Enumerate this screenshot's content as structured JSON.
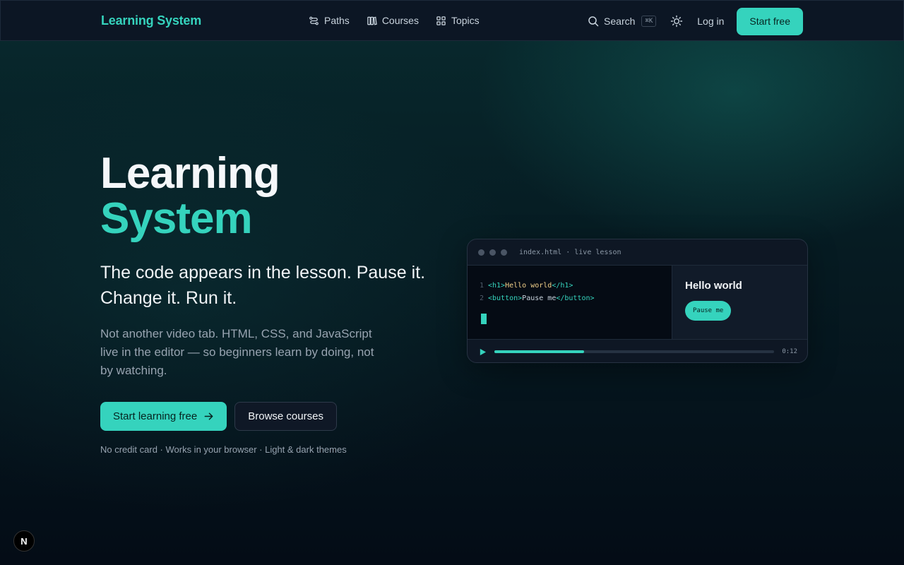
{
  "nav": {
    "brand": "Learning System",
    "links": [
      {
        "label": "Paths",
        "icon": "route-icon"
      },
      {
        "label": "Courses",
        "icon": "books-icon"
      },
      {
        "label": "Topics",
        "icon": "grid-icon"
      }
    ],
    "search_label": "Search",
    "search_shortcut": "⌘K",
    "login_label": "Log in",
    "start_label": "Start free"
  },
  "hero": {
    "title_line1": "Learning",
    "title_line2": "System",
    "subtitle": "The code appears in the lesson. Pause it. Change it. Run it.",
    "description": "Not another video tab. HTML, CSS, and JavaScript live in the editor — so beginners learn by doing, not by watching.",
    "primary_cta": "Start learning free",
    "secondary_cta": "Browse courses",
    "fine_print": "No credit card · Works in your browser · Light & dark themes"
  },
  "lesson_card": {
    "title": "index.html · live lesson",
    "code": [
      {
        "line": "1",
        "open": "<h1>",
        "text": "Hello world",
        "close": "</h1>"
      },
      {
        "line": "2",
        "open": "<button>",
        "text": "Pause me",
        "close": "</button>"
      }
    ],
    "preview_title": "Hello world",
    "preview_button": "Pause me",
    "progress": 0.32,
    "time": "0:12"
  },
  "badge": "N",
  "colors": {
    "accent": "#35d3bd",
    "background": "#061b22",
    "nav_bg": "#0c1624"
  }
}
